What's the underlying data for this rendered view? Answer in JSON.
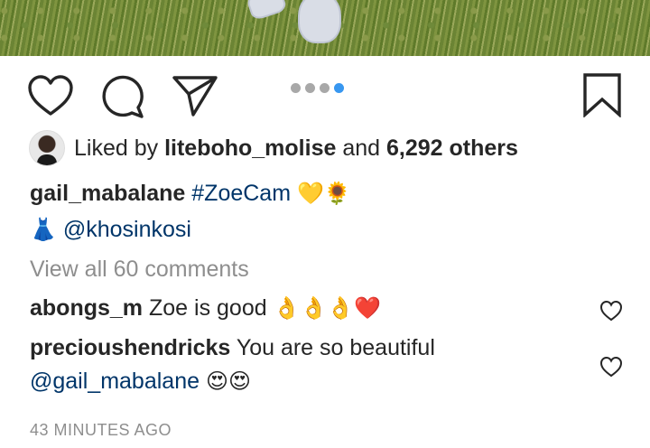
{
  "post": {
    "carousel": {
      "count": 4,
      "active_index": 3
    },
    "likes": {
      "prefix": "Liked by",
      "user": "liteboho_molise",
      "connector": "and",
      "count_text": "6,292 others"
    },
    "caption": {
      "username": "gail_mabalane",
      "hashtag": "#ZoeCam",
      "emojis": "💛🌻",
      "line2_emoji": "👗",
      "mention": "@khosinkosi"
    },
    "view_all_comments": "View all 60 comments",
    "comments": [
      {
        "username": "abongs_m",
        "text": "Zoe is good",
        "emojis": "👌👌👌❤️"
      },
      {
        "username": "precioushendricks",
        "text": "You are so beautiful",
        "mention": "@gail_mabalane",
        "emojis": "😍😍"
      }
    ],
    "timestamp": "43 MINUTES AGO"
  },
  "icons": {
    "like": "heart-icon",
    "comment": "comment-bubble-icon",
    "share": "paper-plane-icon",
    "save": "bookmark-icon"
  },
  "colors": {
    "accent": "#3897f0",
    "link": "#003569",
    "muted": "#8e8e8e",
    "text": "#262626"
  }
}
